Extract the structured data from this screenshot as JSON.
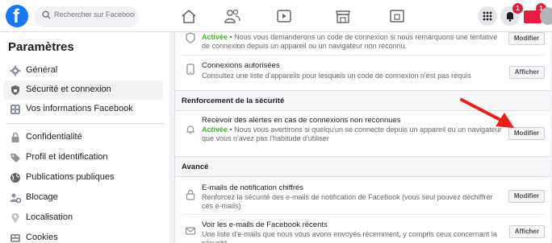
{
  "header": {
    "logo_letter": "f",
    "search_placeholder": "Rechercher sur Facebook",
    "notifications_count": "1",
    "messages_count": "1"
  },
  "sidebar": {
    "title": "Paramètres",
    "items": [
      {
        "label": "Général",
        "icon": "gear-icon"
      },
      {
        "label": "Sécurité et connexion",
        "icon": "shield-icon"
      },
      {
        "label": "Vos informations Facebook",
        "icon": "facebook-info-icon"
      },
      {
        "label": "Confidentialité",
        "icon": "lock-icon"
      },
      {
        "label": "Profil et identification",
        "icon": "tag-icon"
      },
      {
        "label": "Publications publiques",
        "icon": "globe-icon"
      },
      {
        "label": "Blocage",
        "icon": "block-user-icon"
      },
      {
        "label": "Localisation",
        "icon": "location-pin-icon"
      },
      {
        "label": "Cookies",
        "icon": "cookies-icon"
      }
    ]
  },
  "main": {
    "row_login_code": {
      "status": "Activée",
      "desc": " • Nous vous demanderons un code de connexion si nous remarquons une tentative de connexion depuis un appareil ou un navigateur non reconnu.",
      "button": "Modifier"
    },
    "row_authorized": {
      "title": "Connexions autorisées",
      "desc": "Consultez une liste d'appareils pour lesquels un code de connexion n'est pas requis",
      "button": "Afficher"
    },
    "section_security": "Renforcement de la sécurité",
    "row_alerts": {
      "title": "Recevoir des alertes en cas de connexions non reconnues",
      "status": "Activée",
      "desc": " • Nous vous avertirons si quelqu'un se connecte depuis un appareil ou un navigateur que vous n'avez pas l'habitude d'utiliser",
      "button": "Modifier"
    },
    "section_advanced": "Avancé",
    "row_emails_encrypted": {
      "title": "E-mails de notification chiffrés",
      "desc": "Renforcez la sécurité des e-mails de notification de Facebook (vous seul pouvez déchiffrer ces e-mails)",
      "button": "Modifier"
    },
    "row_recent_emails": {
      "title": "Voir les e-mails de Facebook récents",
      "desc": "Une liste d'e-mails que nous vous avons envoyés récemment, y compris ceux concernant la sécurité",
      "button": "Afficher"
    }
  },
  "colors": {
    "brand": "#1877f2",
    "active_green": "#42b72a",
    "badge_red": "#e41e3f",
    "annotation_arrow": "#e8201a"
  }
}
